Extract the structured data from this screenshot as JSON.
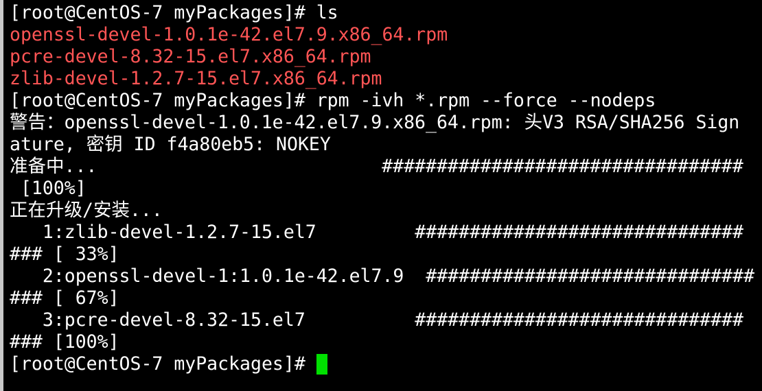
{
  "terminal": {
    "lines": [
      {
        "text": "[root@CentOS-7 myPackages]# ls",
        "color": "#ffffff"
      },
      {
        "text": "openssl-devel-1.0.1e-42.el7.9.x86_64.rpm",
        "color": "#ff5555"
      },
      {
        "text": "pcre-devel-8.32-15.el7.x86_64.rpm",
        "color": "#ff5555"
      },
      {
        "text": "zlib-devel-1.2.7-15.el7.x86_64.rpm",
        "color": "#ff5555"
      },
      {
        "text": "[root@CentOS-7 myPackages]# rpm -ivh *.rpm --force --nodeps",
        "color": "#ffffff"
      },
      {
        "text": "警告：openssl-devel-1.0.1e-42.el7.9.x86_64.rpm: 头V3 RSA/SHA256 Sign",
        "color": "#ffffff"
      },
      {
        "text": "ature, 密钥 ID f4a80eb5: NOKEY",
        "color": "#ffffff"
      },
      {
        "text": "准备中...                          #################################",
        "color": "#ffffff"
      },
      {
        "text": " [100%]",
        "color": "#ffffff"
      },
      {
        "text": "正在升级/安装...",
        "color": "#ffffff"
      },
      {
        "text": "   1:zlib-devel-1.2.7-15.el7         ##############################",
        "color": "#ffffff"
      },
      {
        "text": "### [ 33%]",
        "color": "#ffffff"
      },
      {
        "text": "   2:openssl-devel-1:1.0.1e-42.el7.9  ##############################",
        "color": "#ffffff"
      },
      {
        "text": "### [ 67%]",
        "color": "#ffffff"
      },
      {
        "text": "   3:pcre-devel-8.32-15.el7          ##############################",
        "color": "#ffffff"
      },
      {
        "text": "### [100%]",
        "color": "#ffffff"
      }
    ],
    "prompt": "[root@CentOS-7 myPackages]# ",
    "cursor_color": "#00e000"
  }
}
